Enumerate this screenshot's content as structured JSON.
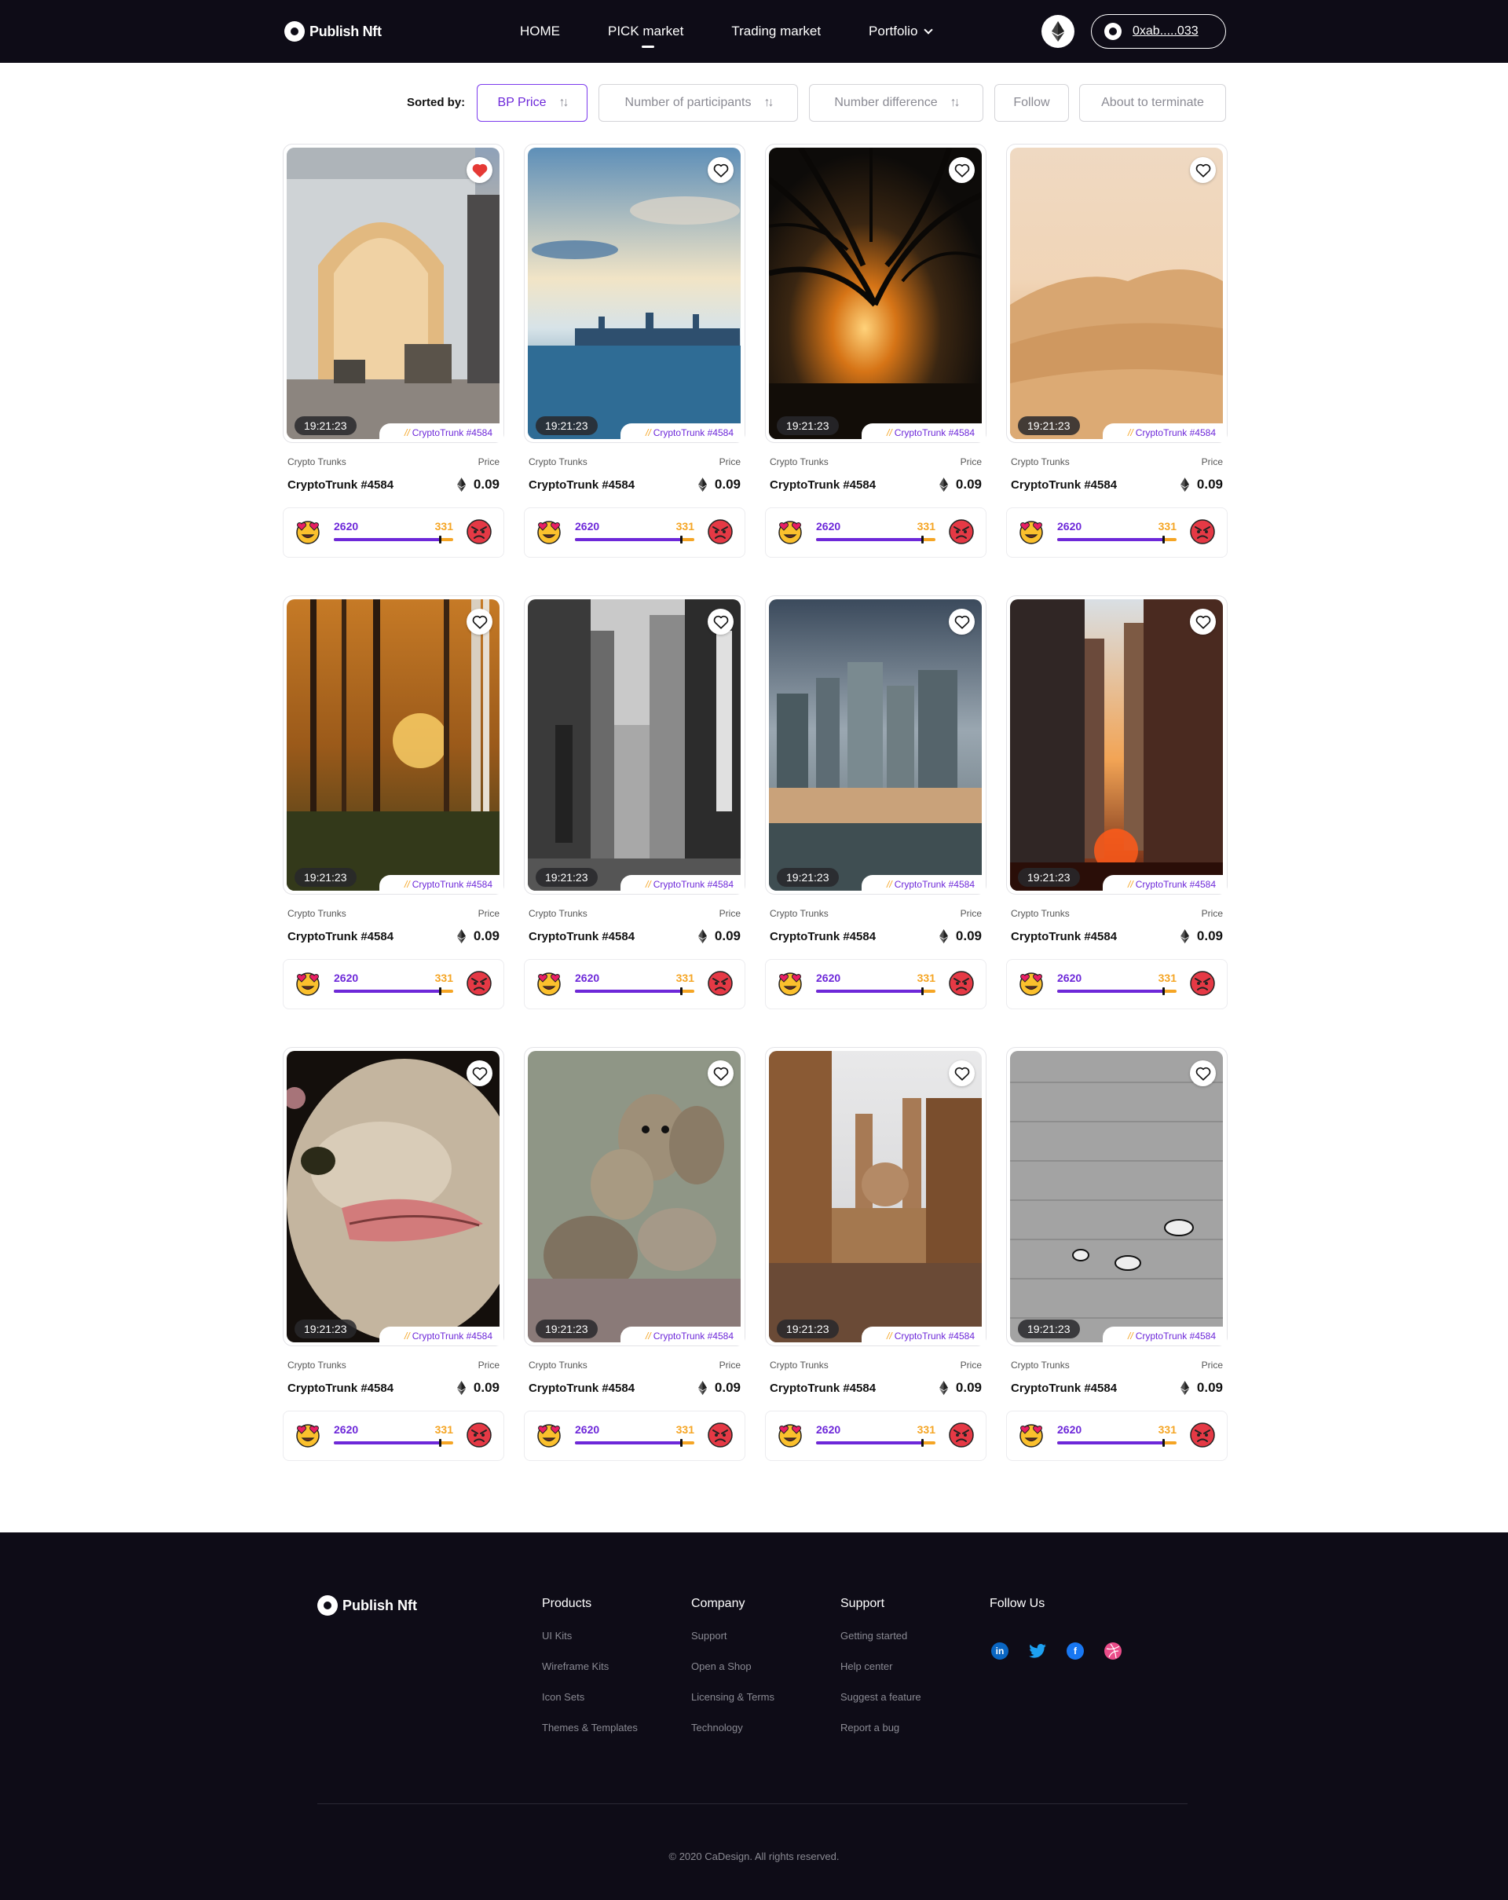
{
  "header": {
    "logo_text": "Publish Nft",
    "nav": [
      {
        "label": "HOME",
        "active": false
      },
      {
        "label": "PICK market",
        "active": true
      },
      {
        "label": "Trading market",
        "active": false
      },
      {
        "label": "Portfolio",
        "active": false,
        "has_dropdown": true
      }
    ],
    "network_icon": "ethereum-icon",
    "wallet_address": "0xab.....033"
  },
  "sort": {
    "label": "Sorted by:",
    "options": [
      {
        "label": "BP Price",
        "active": true,
        "sortable": true
      },
      {
        "label": "Number of participants",
        "active": false,
        "sortable": true
      },
      {
        "label": "Number difference",
        "active": false,
        "sortable": true
      },
      {
        "label": "Follow",
        "active": false,
        "sortable": false
      },
      {
        "label": "About to terminate",
        "active": false,
        "sortable": false
      }
    ]
  },
  "cards": [
    {
      "scene": "arch",
      "liked": true,
      "timer": "19:21:23",
      "tag": "CryptoTrunk #4584",
      "collection": "Crypto Trunks",
      "price_label": "Price",
      "name": "CryptoTrunk #4584",
      "price": "0.09",
      "votes_up": "2620",
      "votes_down": "331",
      "up_ratio": 0.89
    },
    {
      "scene": "harbor",
      "liked": false,
      "timer": "19:21:23",
      "tag": "CryptoTrunk #4584",
      "collection": "Crypto Trunks",
      "price_label": "Price",
      "name": "CryptoTrunk #4584",
      "price": "0.09",
      "votes_up": "2620",
      "votes_down": "331",
      "up_ratio": 0.89
    },
    {
      "scene": "sunset-tree",
      "liked": false,
      "timer": "19:21:23",
      "tag": "CryptoTrunk #4584",
      "collection": "Crypto Trunks",
      "price_label": "Price",
      "name": "CryptoTrunk #4584",
      "price": "0.09",
      "votes_up": "2620",
      "votes_down": "331",
      "up_ratio": 0.89
    },
    {
      "scene": "desert",
      "liked": false,
      "timer": "19:21:23",
      "tag": "CryptoTrunk #4584",
      "collection": "Crypto Trunks",
      "price_label": "Price",
      "name": "CryptoTrunk #4584",
      "price": "0.09",
      "votes_up": "2620",
      "votes_down": "331",
      "up_ratio": 0.89
    },
    {
      "scene": "forest",
      "liked": false,
      "timer": "19:21:23",
      "tag": "CryptoTrunk #4584",
      "collection": "Crypto Trunks",
      "price_label": "Price",
      "name": "CryptoTrunk #4584",
      "price": "0.09",
      "votes_up": "2620",
      "votes_down": "331",
      "up_ratio": 0.89
    },
    {
      "scene": "bw-street",
      "liked": false,
      "timer": "19:21:23",
      "tag": "CryptoTrunk #4584",
      "collection": "Crypto Trunks",
      "price_label": "Price",
      "name": "CryptoTrunk #4584",
      "price": "0.09",
      "votes_up": "2620",
      "votes_down": "331",
      "up_ratio": 0.89
    },
    {
      "scene": "skyline",
      "liked": false,
      "timer": "19:21:23",
      "tag": "CryptoTrunk #4584",
      "collection": "Crypto Trunks",
      "price_label": "Price",
      "name": "CryptoTrunk #4584",
      "price": "0.09",
      "votes_up": "2620",
      "votes_down": "331",
      "up_ratio": 0.89
    },
    {
      "scene": "red-street",
      "liked": false,
      "timer": "19:21:23",
      "tag": "CryptoTrunk #4584",
      "collection": "Crypto Trunks",
      "price_label": "Price",
      "name": "CryptoTrunk #4584",
      "price": "0.09",
      "votes_up": "2620",
      "votes_down": "331",
      "up_ratio": 0.89
    },
    {
      "scene": "ostrich",
      "liked": false,
      "timer": "19:21:23",
      "tag": "CryptoTrunk #4584",
      "collection": "Crypto Trunks",
      "price_label": "Price",
      "name": "CryptoTrunk #4584",
      "price": "0.09",
      "votes_up": "2620",
      "votes_down": "331",
      "up_ratio": 0.89
    },
    {
      "scene": "meerkats",
      "liked": false,
      "timer": "19:21:23",
      "tag": "CryptoTrunk #4584",
      "collection": "Crypto Trunks",
      "price_label": "Price",
      "name": "CryptoTrunk #4584",
      "price": "0.09",
      "votes_up": "2620",
      "votes_down": "331",
      "up_ratio": 0.89
    },
    {
      "scene": "cathedral",
      "liked": false,
      "timer": "19:21:23",
      "tag": "CryptoTrunk #4584",
      "collection": "Crypto Trunks",
      "price_label": "Price",
      "name": "CryptoTrunk #4584",
      "price": "0.09",
      "votes_up": "2620",
      "votes_down": "331",
      "up_ratio": 0.89
    },
    {
      "scene": "zebras",
      "liked": false,
      "timer": "19:21:23",
      "tag": "CryptoTrunk #4584",
      "collection": "Crypto Trunks",
      "price_label": "Price",
      "name": "CryptoTrunk #4584",
      "price": "0.09",
      "votes_up": "2620",
      "votes_down": "331",
      "up_ratio": 0.89
    }
  ],
  "footer": {
    "logo_text": "Publish Nft",
    "columns": [
      {
        "title": "Products",
        "links": [
          "UI Kits",
          "Wireframe Kits",
          "Icon Sets",
          "Themes & Templates"
        ]
      },
      {
        "title": "Company",
        "links": [
          "Support",
          "Open a Shop",
          "Licensing & Terms",
          "Technology"
        ]
      },
      {
        "title": "Support",
        "links": [
          "Getting started",
          "Help center",
          "Suggest a feature",
          "Report a bug"
        ]
      },
      {
        "title": "Follow Us",
        "links": []
      }
    ],
    "socials": [
      {
        "icon": "linkedin-icon",
        "color": "#0a66c2"
      },
      {
        "icon": "twitter-icon",
        "color": "#1da1f2"
      },
      {
        "icon": "facebook-icon",
        "color": "#1877f2"
      },
      {
        "icon": "dribbble-icon",
        "color": "#ea4c89"
      }
    ],
    "copyright": "© 2020 CaDesign. All rights reserved."
  },
  "colors": {
    "accent": "#6d28d9",
    "orange": "#f5a524",
    "dark": "#0e0c17",
    "like_red": "#e53935"
  }
}
